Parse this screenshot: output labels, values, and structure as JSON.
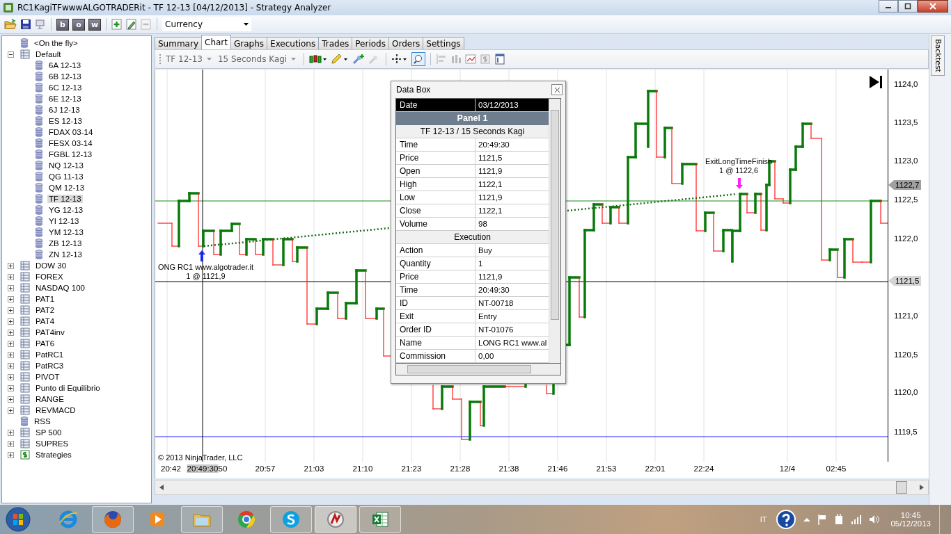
{
  "window": {
    "title": "RC1KagiTFwwwALGOTRADERit - TF 12-13 [04/12/2013] - Strategy Analyzer"
  },
  "toolbar": {
    "letter_buttons": [
      "b",
      "o",
      "w"
    ],
    "instrument_list": {
      "value": "Currency"
    }
  },
  "tree": [
    {
      "label": "<On the fly>",
      "kind": "single"
    },
    {
      "label": "Default",
      "kind": "group",
      "expanded": true,
      "children": [
        {
          "label": "6A 12-13",
          "selected": false
        },
        {
          "label": "6B 12-13",
          "selected": false
        },
        {
          "label": "6C 12-13",
          "selected": false
        },
        {
          "label": "6E 12-13",
          "selected": false
        },
        {
          "label": "6J 12-13",
          "selected": false
        },
        {
          "label": "ES 12-13",
          "selected": false
        },
        {
          "label": "FDAX 03-14",
          "selected": false
        },
        {
          "label": "FESX 03-14",
          "selected": false
        },
        {
          "label": "FGBL 12-13",
          "selected": false
        },
        {
          "label": "NQ 12-13",
          "selected": false
        },
        {
          "label": "QG 11-13",
          "selected": false
        },
        {
          "label": "QM 12-13",
          "selected": false
        },
        {
          "label": "TF 12-13",
          "selected": true
        },
        {
          "label": "YG 12-13",
          "selected": false
        },
        {
          "label": "YI 12-13",
          "selected": false
        },
        {
          "label": "YM 12-13",
          "selected": false
        },
        {
          "label": "ZB 12-13",
          "selected": false
        },
        {
          "label": "ZN 12-13",
          "selected": false
        }
      ]
    },
    {
      "label": "DOW 30",
      "kind": "group",
      "expanded": false
    },
    {
      "label": "FOREX",
      "kind": "group",
      "expanded": false
    },
    {
      "label": "NASDAQ 100",
      "kind": "group",
      "expanded": false
    },
    {
      "label": "PAT1",
      "kind": "group",
      "expanded": false
    },
    {
      "label": "PAT2",
      "kind": "group",
      "expanded": false
    },
    {
      "label": "PAT4",
      "kind": "group",
      "expanded": false
    },
    {
      "label": "PAT4inv",
      "kind": "group",
      "expanded": false
    },
    {
      "label": "PAT6",
      "kind": "group",
      "expanded": false
    },
    {
      "label": "PatRC1",
      "kind": "group",
      "expanded": false
    },
    {
      "label": "PatRC3",
      "kind": "group",
      "expanded": false
    },
    {
      "label": "PIVOT",
      "kind": "group",
      "expanded": false
    },
    {
      "label": "Punto di Equilibrio",
      "kind": "group",
      "expanded": false
    },
    {
      "label": "RANGE",
      "kind": "group",
      "expanded": false
    },
    {
      "label": "REVMACD",
      "kind": "group",
      "expanded": false
    },
    {
      "label": "RSS",
      "kind": "single"
    },
    {
      "label": "SP 500",
      "kind": "group",
      "expanded": false
    },
    {
      "label": "SUPRES",
      "kind": "group",
      "expanded": false
    },
    {
      "label": "Strategies",
      "kind": "strategy",
      "expanded": false
    }
  ],
  "tabs": [
    {
      "label": "Summary",
      "selected": false
    },
    {
      "label": "Chart",
      "selected": true
    },
    {
      "label": "Graphs",
      "selected": false
    },
    {
      "label": "Executions",
      "selected": false
    },
    {
      "label": "Trades",
      "selected": false
    },
    {
      "label": "Periods",
      "selected": false
    },
    {
      "label": "Orders",
      "selected": false
    },
    {
      "label": "Settings",
      "selected": false
    }
  ],
  "chart_toolbar": {
    "instrument": "TF 12-13",
    "period": "15 Seconds Kagi"
  },
  "chart": {
    "price_labels": [
      "1124,0",
      "1123,5",
      "1123,0",
      "1122,5",
      "1122,0",
      "1121,0",
      "1120,5",
      "1120,0",
      "1119,5"
    ],
    "price_tags": [
      {
        "label": "1122,7",
        "kind": "last"
      },
      {
        "label": "1121,5",
        "kind": "cursor"
      }
    ],
    "time_labels": [
      "20:42",
      "50",
      "20:57",
      "21:03",
      "21:10",
      "21:23",
      "21:28",
      "21:38",
      "21:46",
      "21:53",
      "22:01",
      "22:24",
      "12/4",
      "02:45"
    ],
    "crosshair_time": "20:49:30",
    "executions": [
      {
        "kind": "entry",
        "name": "ONG RC1 www.algotrader.it",
        "fill": "1 @ 1121,9"
      },
      {
        "kind": "exit",
        "name": "ExitLongTimeFinish",
        "fill": "1 @ 1122,6"
      }
    ],
    "copyright": "© 2013 NinjaTrader, LLC"
  },
  "data_box": {
    "title": "Data Box",
    "rows": [
      {
        "kind": "header",
        "label": "Date",
        "value": "03/12/2013"
      },
      {
        "kind": "section",
        "label": "Panel 1"
      },
      {
        "kind": "subsection",
        "label": "TF 12-13 / 15 Seconds Kagi"
      },
      {
        "kind": "row",
        "label": "Time",
        "value": "20:49:30"
      },
      {
        "kind": "row",
        "label": "Price",
        "value": "1121,5"
      },
      {
        "kind": "row",
        "label": "Open",
        "value": "1121,9"
      },
      {
        "kind": "row",
        "label": "High",
        "value": "1122,1"
      },
      {
        "kind": "row",
        "label": "Low",
        "value": "1121,9"
      },
      {
        "kind": "row",
        "label": "Close",
        "value": "1122,1"
      },
      {
        "kind": "row",
        "label": "Volume",
        "value": "98"
      },
      {
        "kind": "subsection",
        "label": "Execution"
      },
      {
        "kind": "row",
        "label": "Action",
        "value": "Buy"
      },
      {
        "kind": "row",
        "label": "Quantity",
        "value": "1"
      },
      {
        "kind": "row",
        "label": "Price",
        "value": "1121,9"
      },
      {
        "kind": "row",
        "label": "Time",
        "value": "20:49:30"
      },
      {
        "kind": "row",
        "label": "ID",
        "value": "NT-00718"
      },
      {
        "kind": "row",
        "label": "Exit",
        "value": "Entry"
      },
      {
        "kind": "row",
        "label": "Order ID",
        "value": "NT-01076"
      },
      {
        "kind": "row",
        "label": "Name",
        "value": "LONG RC1 www.al"
      },
      {
        "kind": "row",
        "label": "Commission",
        "value": "0,00"
      }
    ]
  },
  "side_tab": {
    "label": "Backtest"
  },
  "taskbar": {
    "apps": [
      {
        "kind": "ie",
        "running": false,
        "selected": false
      },
      {
        "kind": "firefox",
        "running": true,
        "selected": false
      },
      {
        "kind": "media",
        "running": false,
        "selected": false
      },
      {
        "kind": "folder",
        "running": true,
        "selected": false
      },
      {
        "kind": "chrome",
        "running": false,
        "selected": false
      },
      {
        "kind": "skype",
        "running": true,
        "selected": false
      },
      {
        "kind": "ninja",
        "running": true,
        "selected": true
      },
      {
        "kind": "excel",
        "running": true,
        "selected": false
      }
    ],
    "language": "IT",
    "time": "10:45",
    "date": "05/12/2013"
  }
}
